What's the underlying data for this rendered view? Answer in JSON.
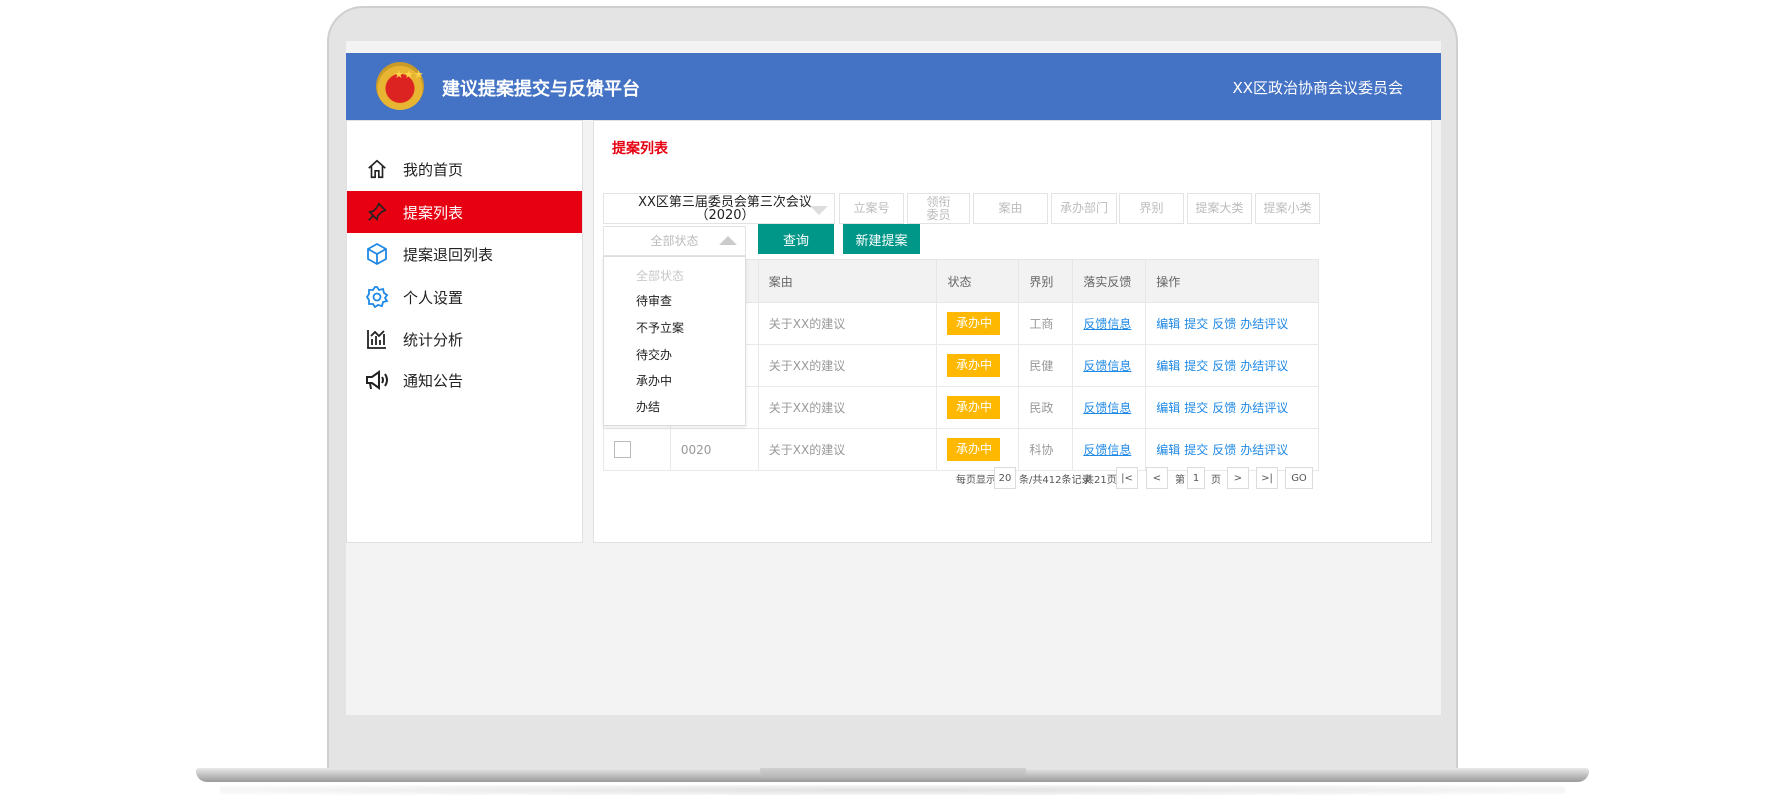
{
  "header": {
    "title": "建议提案提交与反馈平台",
    "org": "XX区政治协商会议委员会"
  },
  "sidebar": {
    "items": [
      {
        "label": "我的首页",
        "icon": "home-icon"
      },
      {
        "label": "提案列表",
        "icon": "pin-icon",
        "active": true
      },
      {
        "label": "提案退回列表",
        "icon": "cube-icon"
      },
      {
        "label": "个人设置",
        "icon": "gear-icon"
      },
      {
        "label": "统计分析",
        "icon": "chart-icon"
      },
      {
        "label": "通知公告",
        "icon": "megaphone-icon"
      }
    ]
  },
  "main": {
    "title": "提案列表",
    "filters": {
      "session": "XX区第三届委员会第三次会议（2020）",
      "case_no": "立案号",
      "lead_member_line1": "领衔",
      "lead_member_line2": "委员",
      "reason": "案由",
      "department": "承办部门",
      "sector": "界别",
      "category_major": "提案大类",
      "category_minor": "提案小类",
      "status": "全部状态"
    },
    "buttons": {
      "query": "查询",
      "new": "新建提案"
    },
    "status_dropdown": {
      "options": [
        "全部状态",
        "待审查",
        "不予立案",
        "待交办",
        "承办中",
        "办结"
      ]
    },
    "table": {
      "headers": [
        "",
        "",
        "案由",
        "状态",
        "界别",
        "落实反馈",
        "操作"
      ],
      "rows": [
        {
          "no": "",
          "reason": "关于XX的建议",
          "status": "承办中",
          "sector": "工商",
          "feedback": "反馈信息"
        },
        {
          "no": "",
          "reason": "关于XX的建议",
          "status": "承办中",
          "sector": "民健",
          "feedback": "反馈信息"
        },
        {
          "no": "",
          "reason": "关于XX的建议",
          "status": "承办中",
          "sector": "民政",
          "feedback": "反馈信息"
        },
        {
          "no": "0020",
          "reason": "关于XX的建议",
          "status": "承办中",
          "sector": "科协",
          "feedback": "反馈信息"
        }
      ],
      "actions": {
        "edit": "编辑",
        "submit": "提交",
        "feedback": "反馈",
        "evaluate": "办结评议"
      }
    },
    "pagination": {
      "per_page_label": "每页显示",
      "per_page": "20",
      "total_label": "条/共412条记录",
      "pages_label": "共21页",
      "page_prefix": "第",
      "current_page": "1",
      "page_suffix": "页",
      "go": "GO"
    }
  },
  "colors": {
    "header": "#4472c4",
    "active": "#e60012",
    "button": "#009688",
    "badge": "#ffb800",
    "link": "#1e88e5"
  }
}
